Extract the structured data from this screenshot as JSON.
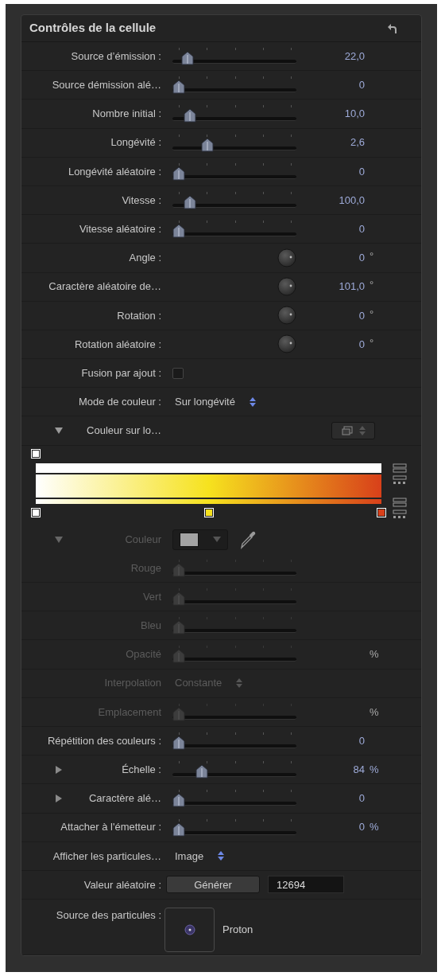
{
  "panel": {
    "title": "Contrôles de la cellule"
  },
  "rows": [
    {
      "kind": "slider",
      "label": "Source d’émission :",
      "level": 0.08,
      "value": "22,0",
      "disabled": false
    },
    {
      "kind": "slider",
      "label": "Source démission alé…",
      "level": 0,
      "value": "0",
      "disabled": false
    },
    {
      "kind": "slider",
      "label": "Nombre initial :",
      "level": 0.1,
      "value": "10,0",
      "disabled": false
    },
    {
      "kind": "slider",
      "label": "Longévité :",
      "level": 0.26,
      "value": "2,6",
      "disabled": false
    },
    {
      "kind": "slider",
      "label": "Longévité aléatoire :",
      "level": 0,
      "value": "0",
      "disabled": false
    },
    {
      "kind": "slider",
      "label": "Vitesse :",
      "level": 0.1,
      "value": "100,0",
      "disabled": false
    },
    {
      "kind": "slider",
      "label": "Vitesse aléatoire :",
      "level": 0,
      "value": "0",
      "disabled": false
    },
    {
      "kind": "dial",
      "label": "Angle :",
      "value": "0",
      "unit": "°",
      "disabled": false
    },
    {
      "kind": "dial",
      "label": "Caractère aléatoire de…",
      "value": "101,0",
      "unit": "°",
      "disabled": false
    },
    {
      "kind": "dial",
      "label": "Rotation :",
      "value": "0",
      "unit": "°",
      "disabled": false
    },
    {
      "kind": "dial",
      "label": "Rotation aléatoire :",
      "value": "0",
      "unit": "°",
      "disabled": false
    },
    {
      "kind": "checkbox",
      "label": "Fusion par ajout :",
      "checked": false,
      "disabled": false
    },
    {
      "kind": "popup",
      "label": "Mode de couleur :",
      "value": "Sur longévité",
      "disabled": false
    },
    {
      "kind": "group",
      "label": "Couleur sur lo…",
      "expanded": true,
      "disabled": false
    },
    {
      "kind": "gradient",
      "opacity_stops": [
        {
          "color": "#ffffff"
        }
      ],
      "color_stops": [
        {
          "color": "#ffffff"
        },
        {
          "color": "#f6e21e"
        },
        {
          "color": "#d8401a"
        }
      ]
    },
    {
      "kind": "color",
      "label": "Couleur",
      "expanded": true,
      "color": "#a3a3a3",
      "disabled": true
    },
    {
      "kind": "slider",
      "label": "Rouge",
      "level": 0,
      "disabled": true
    },
    {
      "kind": "slider",
      "label": "Vert",
      "level": 0,
      "disabled": true
    },
    {
      "kind": "slider",
      "label": "Bleu",
      "level": 0,
      "disabled": true
    },
    {
      "kind": "slider",
      "label": "Opacité",
      "level": 0,
      "unit": "%",
      "disabled": true
    },
    {
      "kind": "popup",
      "label": "Interpolation",
      "value": "Constante",
      "disabled": true
    },
    {
      "kind": "slider",
      "label": "Emplacement",
      "level": 0,
      "unit": "%",
      "disabled": true
    },
    {
      "kind": "slider",
      "label": "Répétition des couleurs :",
      "level": 0,
      "value": "0",
      "disabled": false
    },
    {
      "kind": "slider",
      "label": "Échelle :",
      "expanded": false,
      "level": 0.21,
      "value": "84",
      "unit": "%",
      "disabled": false
    },
    {
      "kind": "slider",
      "label": "Caractère alé…",
      "expanded": false,
      "level": 0,
      "value": "0",
      "disabled": false
    },
    {
      "kind": "slider",
      "label": "Attacher à l'émetteur :",
      "level": 0,
      "value": "0",
      "unit": "%",
      "disabled": false
    },
    {
      "kind": "popup",
      "label": "Afficher les particules…",
      "value": "Image",
      "disabled": false
    },
    {
      "kind": "generate",
      "label": "Valeur aléatoire :",
      "button": "Générer",
      "value": "12694",
      "disabled": false
    },
    {
      "kind": "source",
      "label": "Source des particules :",
      "value": "Proton",
      "disabled": false
    }
  ]
}
